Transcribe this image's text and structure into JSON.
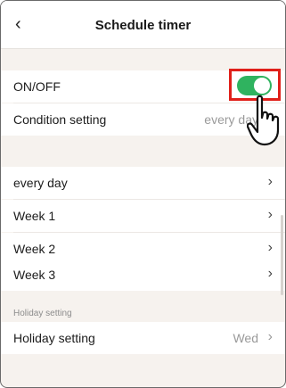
{
  "header": {
    "title": "Schedule timer",
    "back_icon": "chevron-left-icon"
  },
  "settings": {
    "onoff_label": "ON/OFF",
    "onoff_state": true,
    "condition_label": "Condition setting",
    "condition_value": "every day"
  },
  "schedules": [
    {
      "label": "every day"
    },
    {
      "label": "Week 1"
    },
    {
      "label": "Week 2"
    },
    {
      "label": "Week 3"
    }
  ],
  "holiday": {
    "caption": "Holiday setting",
    "label": "Holiday setting",
    "value": "Wed"
  },
  "colors": {
    "toggle_on": "#2fb35f",
    "highlight": "#e0201a"
  }
}
